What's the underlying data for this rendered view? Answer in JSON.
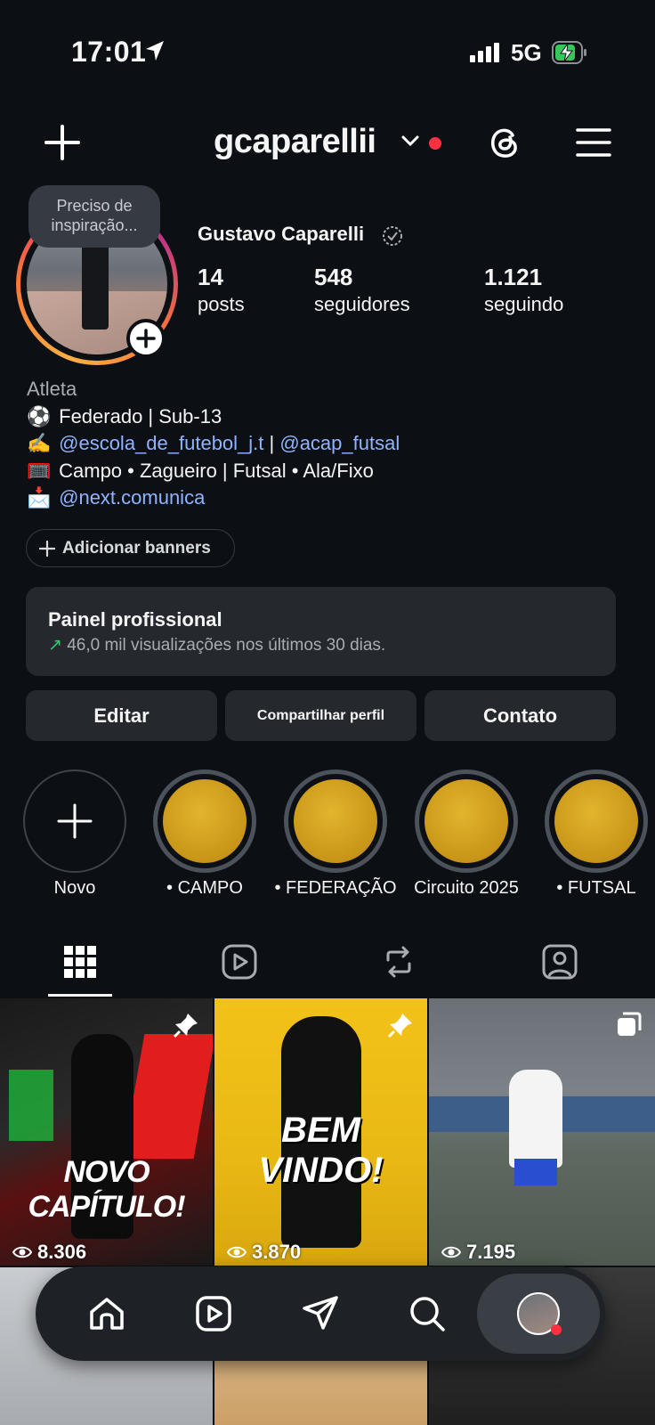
{
  "status_bar": {
    "time": "17:01",
    "network": "5G"
  },
  "header": {
    "username": "gcaparellii"
  },
  "profile": {
    "note": "Preciso de inspiração...",
    "name": "Gustavo Caparelli",
    "stats": [
      {
        "number": "14",
        "label": "posts"
      },
      {
        "number": "548",
        "label": "seguidores"
      },
      {
        "number": "1.121",
        "label": "seguindo"
      }
    ]
  },
  "bio": {
    "category": "Atleta",
    "line1": "Federado | Sub-13",
    "link1": "@escola_de_futebol_j.t",
    "separator": " | ",
    "link2": "@acap_futsal",
    "line3": "Campo • Zagueiro | Futsal • Ala/Fixo",
    "link3": "@next.comunica",
    "emojis": [
      "⚽",
      "✍️",
      "🥅",
      "📩"
    ]
  },
  "add_banners": "Adicionar banners",
  "professional_panel": {
    "title": "Painel profissional",
    "subtitle": "46,0 mil visualizações nos últimos 30 dias."
  },
  "actions": {
    "edit": "Editar",
    "share": "Compartilhar perfil",
    "contact": "Contato"
  },
  "highlights": [
    {
      "label": "Novo"
    },
    {
      "label": "• CAMPO"
    },
    {
      "label": "• FEDERAÇÃO"
    },
    {
      "label": "Circuito 2025"
    },
    {
      "label": "• FUTSAL"
    }
  ],
  "posts": [
    {
      "views": "8.306",
      "pinned": true,
      "caption": "NOVO CAPÍTULO!"
    },
    {
      "views": "3.870",
      "pinned": true,
      "caption": "BEM VINDO!"
    },
    {
      "views": "7.195",
      "pinned": false,
      "caption": ""
    }
  ],
  "colors": {
    "background": "#0c1014",
    "link": "#8fb3ff",
    "notification": "#ff3040",
    "surface": "#25292e"
  }
}
